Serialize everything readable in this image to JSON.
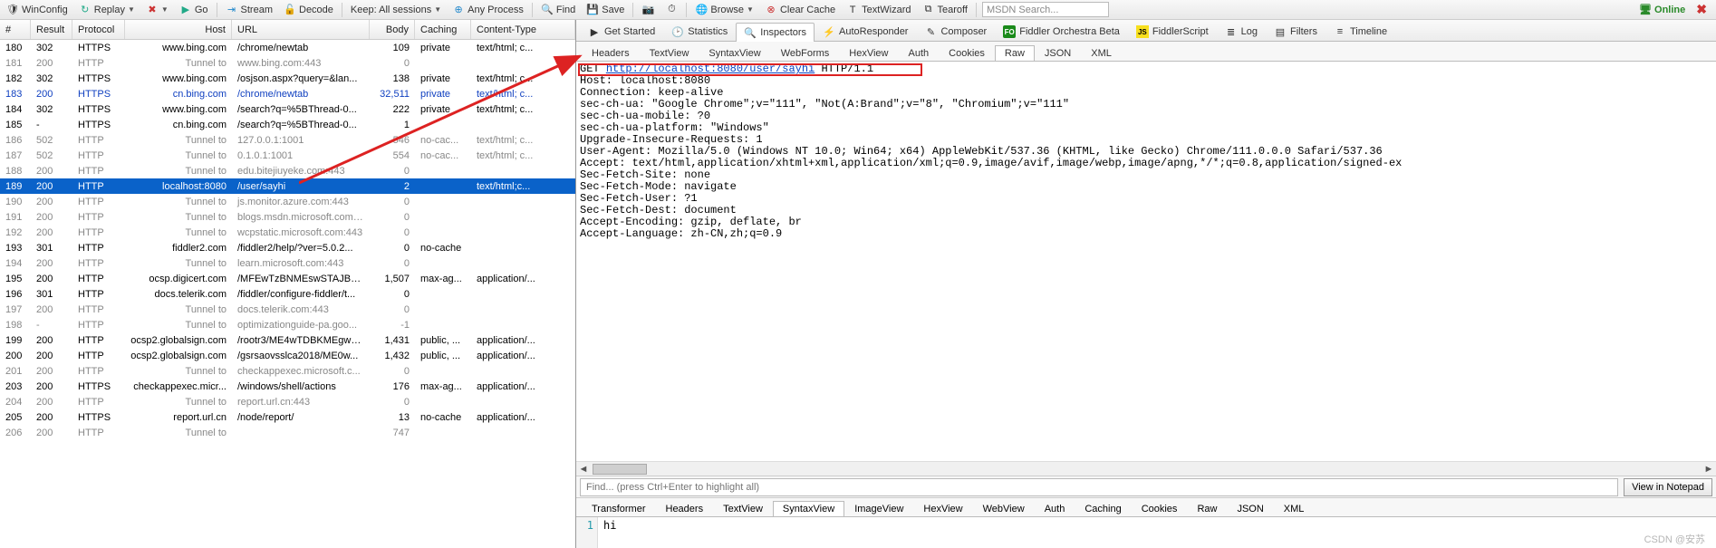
{
  "toolbar": {
    "winconfig": "WinConfig",
    "replay": "Replay",
    "go": "Go",
    "stream": "Stream",
    "decode": "Decode",
    "keep": "Keep: All sessions",
    "process": "Any Process",
    "find": "Find",
    "save": "Save",
    "browse": "Browse",
    "clearcache": "Clear Cache",
    "textwizard": "TextWizard",
    "tearoff": "Tearoff",
    "search_placeholder": "MSDN Search...",
    "online": "Online"
  },
  "grid": {
    "headers": {
      "id": "#",
      "result": "Result",
      "protocol": "Protocol",
      "host": "Host",
      "url": "URL",
      "body": "Body",
      "caching": "Caching",
      "ct": "Content-Type"
    },
    "rows": [
      {
        "id": "180",
        "res": "302",
        "proto": "HTTPS",
        "host": "www.bing.com",
        "url": "/chrome/newtab",
        "body": "109",
        "cache": "private",
        "ct": "text/html; c...",
        "cls": ""
      },
      {
        "id": "181",
        "res": "200",
        "proto": "HTTP",
        "host": "Tunnel to",
        "url": "www.bing.com:443",
        "body": "0",
        "cache": "",
        "ct": "",
        "cls": "tunnel"
      },
      {
        "id": "182",
        "res": "302",
        "proto": "HTTPS",
        "host": "www.bing.com",
        "url": "/osjson.aspx?query=&lan...",
        "body": "138",
        "cache": "private",
        "ct": "text/html; c...",
        "cls": ""
      },
      {
        "id": "183",
        "res": "200",
        "proto": "HTTPS",
        "host": "cn.bing.com",
        "url": "/chrome/newtab",
        "body": "32,511",
        "cache": "private",
        "ct": "text/html; c...",
        "cls": "blue"
      },
      {
        "id": "184",
        "res": "302",
        "proto": "HTTPS",
        "host": "www.bing.com",
        "url": "/search?q=%5BThread-0...",
        "body": "222",
        "cache": "private",
        "ct": "text/html; c...",
        "cls": ""
      },
      {
        "id": "185",
        "res": "-",
        "proto": "HTTPS",
        "host": "cn.bing.com",
        "url": "/search?q=%5BThread-0...",
        "body": "1",
        "cache": "",
        "ct": "",
        "cls": ""
      },
      {
        "id": "186",
        "res": "502",
        "proto": "HTTP",
        "host": "Tunnel to",
        "url": "127.0.0.1:1001",
        "body": "546",
        "cache": "no-cac...",
        "ct": "text/html; c...",
        "cls": "tunnel"
      },
      {
        "id": "187",
        "res": "502",
        "proto": "HTTP",
        "host": "Tunnel to",
        "url": "0.1.0.1:1001",
        "body": "554",
        "cache": "no-cac...",
        "ct": "text/html; c...",
        "cls": "tunnel"
      },
      {
        "id": "188",
        "res": "200",
        "proto": "HTTP",
        "host": "Tunnel to",
        "url": "edu.bitejiuyeke.com:443",
        "body": "0",
        "cache": "",
        "ct": "",
        "cls": "tunnel"
      },
      {
        "id": "189",
        "res": "200",
        "proto": "HTTP",
        "host": "localhost:8080",
        "url": "/user/sayhi",
        "body": "2",
        "cache": "",
        "ct": "text/html;c...",
        "cls": "sel"
      },
      {
        "id": "190",
        "res": "200",
        "proto": "HTTP",
        "host": "Tunnel to",
        "url": "js.monitor.azure.com:443",
        "body": "0",
        "cache": "",
        "ct": "",
        "cls": "tunnel"
      },
      {
        "id": "191",
        "res": "200",
        "proto": "HTTP",
        "host": "Tunnel to",
        "url": "blogs.msdn.microsoft.com:443",
        "body": "0",
        "cache": "",
        "ct": "",
        "cls": "tunnel"
      },
      {
        "id": "192",
        "res": "200",
        "proto": "HTTP",
        "host": "Tunnel to",
        "url": "wcpstatic.microsoft.com:443",
        "body": "0",
        "cache": "",
        "ct": "",
        "cls": "tunnel"
      },
      {
        "id": "193",
        "res": "301",
        "proto": "HTTP",
        "host": "fiddler2.com",
        "url": "/fiddler2/help/?ver=5.0.2...",
        "body": "0",
        "cache": "no-cache",
        "ct": "",
        "cls": ""
      },
      {
        "id": "194",
        "res": "200",
        "proto": "HTTP",
        "host": "Tunnel to",
        "url": "learn.microsoft.com:443",
        "body": "0",
        "cache": "",
        "ct": "",
        "cls": "tunnel"
      },
      {
        "id": "195",
        "res": "200",
        "proto": "HTTP",
        "host": "ocsp.digicert.com",
        "url": "/MFEwTzBNMEswSTAJBgU...",
        "body": "1,507",
        "cache": "max-ag...",
        "ct": "application/...",
        "cls": ""
      },
      {
        "id": "196",
        "res": "301",
        "proto": "HTTP",
        "host": "docs.telerik.com",
        "url": "/fiddler/configure-fiddler/t...",
        "body": "0",
        "cache": "",
        "ct": "",
        "cls": ""
      },
      {
        "id": "197",
        "res": "200",
        "proto": "HTTP",
        "host": "Tunnel to",
        "url": "docs.telerik.com:443",
        "body": "0",
        "cache": "",
        "ct": "",
        "cls": "tunnel"
      },
      {
        "id": "198",
        "res": "-",
        "proto": "HTTP",
        "host": "Tunnel to",
        "url": "optimizationguide-pa.goo...",
        "body": "-1",
        "cache": "",
        "ct": "",
        "cls": "tunnel"
      },
      {
        "id": "199",
        "res": "200",
        "proto": "HTTP",
        "host": "ocsp2.globalsign.com",
        "url": "/rootr3/ME4wTDBKMEgwR...",
        "body": "1,431",
        "cache": "public, ...",
        "ct": "application/...",
        "cls": ""
      },
      {
        "id": "200",
        "res": "200",
        "proto": "HTTP",
        "host": "ocsp2.globalsign.com",
        "url": "/gsrsaovsslca2018/ME0w...",
        "body": "1,432",
        "cache": "public, ...",
        "ct": "application/...",
        "cls": ""
      },
      {
        "id": "201",
        "res": "200",
        "proto": "HTTP",
        "host": "Tunnel to",
        "url": "checkappexec.microsoft.c...",
        "body": "0",
        "cache": "",
        "ct": "",
        "cls": "tunnel"
      },
      {
        "id": "203",
        "res": "200",
        "proto": "HTTPS",
        "host": "checkappexec.micr...",
        "url": "/windows/shell/actions",
        "body": "176",
        "cache": "max-ag...",
        "ct": "application/...",
        "cls": ""
      },
      {
        "id": "204",
        "res": "200",
        "proto": "HTTP",
        "host": "Tunnel to",
        "url": "report.url.cn:443",
        "body": "0",
        "cache": "",
        "ct": "",
        "cls": "tunnel"
      },
      {
        "id": "205",
        "res": "200",
        "proto": "HTTPS",
        "host": "report.url.cn",
        "url": "/node/report/",
        "body": "13",
        "cache": "no-cache",
        "ct": "application/...",
        "cls": ""
      },
      {
        "id": "206",
        "res": "200",
        "proto": "HTTP",
        "host": "Tunnel to",
        "url": "",
        "body": "747",
        "cache": "",
        "ct": "",
        "cls": "tunnel"
      }
    ]
  },
  "insp_tabs1": [
    {
      "label": "Get Started",
      "icon": "play-icon"
    },
    {
      "label": "Statistics",
      "icon": "clock-icon"
    },
    {
      "label": "Inspectors",
      "icon": "magnifier-icon",
      "active": true
    },
    {
      "label": "AutoResponder",
      "icon": "bolt-icon"
    },
    {
      "label": "Composer",
      "icon": "compose-icon"
    },
    {
      "label": "Fiddler Orchestra Beta",
      "icon": "fo-icon"
    },
    {
      "label": "FiddlerScript",
      "icon": "js-icon"
    },
    {
      "label": "Log",
      "icon": "log-icon"
    },
    {
      "label": "Filters",
      "icon": "filter-icon"
    },
    {
      "label": "Timeline",
      "icon": "timeline-icon"
    }
  ],
  "req_tabs": [
    "Headers",
    "TextView",
    "SyntaxView",
    "WebForms",
    "HexView",
    "Auth",
    "Cookies",
    "Raw",
    "JSON",
    "XML"
  ],
  "req_tab_active": "Raw",
  "raw_request": {
    "method": "GET",
    "url": "http://localhost:8080/user/sayhi",
    "version": "HTTP/1.1",
    "headers_text": "Host: localhost:8080\nConnection: keep-alive\nsec-ch-ua: \"Google Chrome\";v=\"111\", \"Not(A:Brand\";v=\"8\", \"Chromium\";v=\"111\"\nsec-ch-ua-mobile: ?0\nsec-ch-ua-platform: \"Windows\"\nUpgrade-Insecure-Requests: 1\nUser-Agent: Mozilla/5.0 (Windows NT 10.0; Win64; x64) AppleWebKit/537.36 (KHTML, like Gecko) Chrome/111.0.0.0 Safari/537.36\nAccept: text/html,application/xhtml+xml,application/xml;q=0.9,image/avif,image/webp,image/apng,*/*;q=0.8,application/signed-ex\nSec-Fetch-Site: none\nSec-Fetch-Mode: navigate\nSec-Fetch-User: ?1\nSec-Fetch-Dest: document\nAccept-Encoding: gzip, deflate, br\nAccept-Language: zh-CN,zh;q=0.9"
  },
  "findbar": {
    "placeholder": "Find... (press Ctrl+Enter to highlight all)",
    "button": "View in Notepad"
  },
  "resp_tabs": [
    "Transformer",
    "Headers",
    "TextView",
    "SyntaxView",
    "ImageView",
    "HexView",
    "WebView",
    "Auth",
    "Caching",
    "Cookies",
    "Raw",
    "JSON",
    "XML"
  ],
  "resp_tab_active": "SyntaxView",
  "resp_body": {
    "lineno": "1",
    "text": "hi"
  },
  "watermark": "CSDN @安苏"
}
